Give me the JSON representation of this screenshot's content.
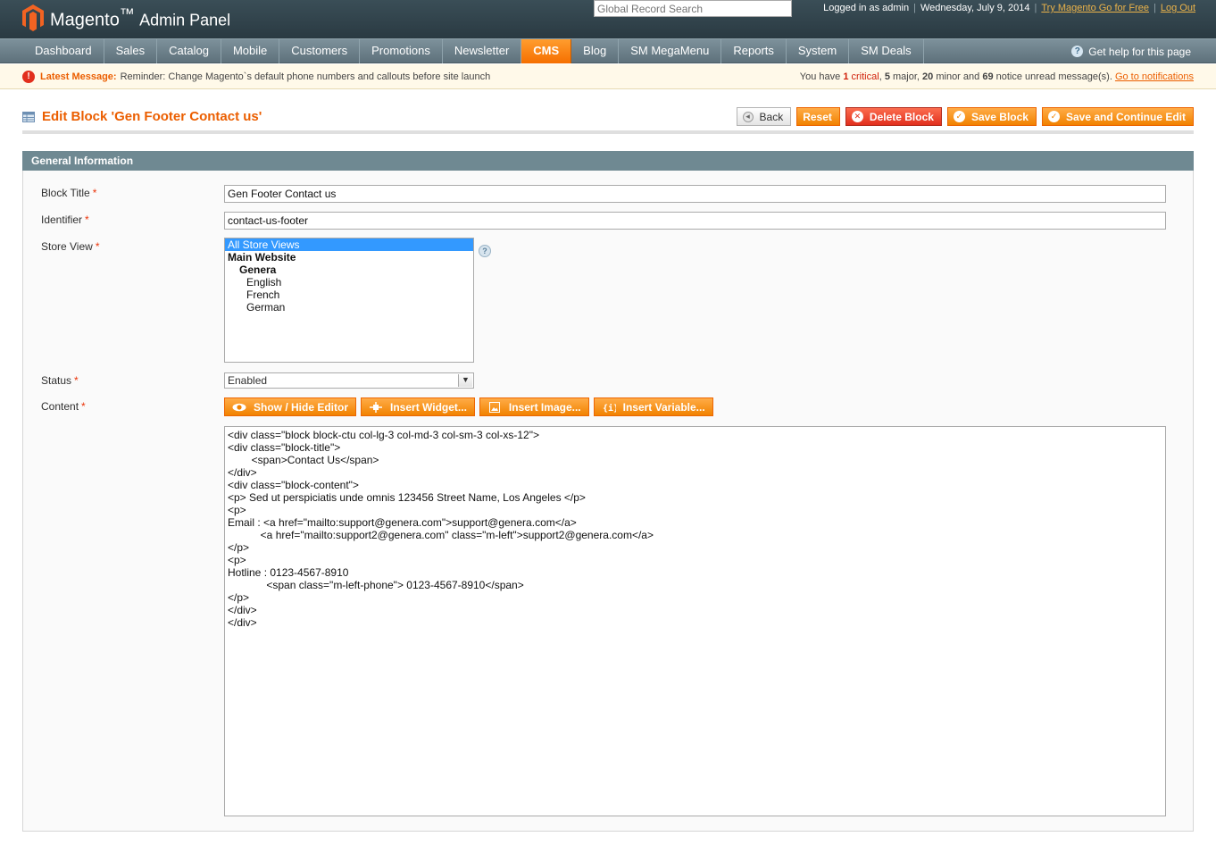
{
  "header": {
    "logo_brand": "Magento",
    "logo_sub": "Admin Panel",
    "search_placeholder": "Global Record Search",
    "logged_in": "Logged in as admin",
    "date": "Wednesday, July 9, 2014",
    "try_link": "Try Magento Go for Free",
    "logout_link": "Log Out"
  },
  "nav": {
    "items": [
      "Dashboard",
      "Sales",
      "Catalog",
      "Mobile",
      "Customers",
      "Promotions",
      "Newsletter",
      "CMS",
      "Blog",
      "SM MegaMenu",
      "Reports",
      "System",
      "SM Deals"
    ],
    "active": "CMS",
    "help": "Get help for this page"
  },
  "notice": {
    "label": "Latest Message:",
    "message": "Reminder: Change Magento`s default phone numbers and callouts before site launch",
    "pre": "You have",
    "critical_count": "1",
    "critical_label": "critical",
    "major_count": "5",
    "major_label": "major,",
    "minor_count": "20",
    "minor_label": "minor and",
    "notice_count": "69",
    "notice_label": "notice unread message(s).",
    "link": "Go to notifications"
  },
  "page": {
    "title": "Edit Block 'Gen Footer Contact us'",
    "buttons": {
      "back": "Back",
      "reset": "Reset",
      "delete": "Delete Block",
      "save": "Save Block",
      "save_continue": "Save and Continue Edit"
    }
  },
  "form": {
    "section_title": "General Information",
    "block_title_label": "Block Title",
    "block_title_value": "Gen Footer Contact us",
    "identifier_label": "Identifier",
    "identifier_value": "contact-us-footer",
    "store_view_label": "Store View",
    "store_options": {
      "all": "All Store Views",
      "website": "Main Website",
      "store": "Genera",
      "english": "English",
      "french": "French",
      "german": "German"
    },
    "status_label": "Status",
    "status_value": "Enabled",
    "content_label": "Content",
    "required_mark": "*",
    "editor_buttons": {
      "show_hide": "Show / Hide Editor",
      "widget": "Insert Widget...",
      "image": "Insert Image...",
      "variable": "Insert Variable..."
    },
    "content": "<div class=\"block block-ctu col-lg-3 col-md-3 col-sm-3 col-xs-12\">\n<div class=\"block-title\">\n        <span>Contact Us</span>\n</div>\n<div class=\"block-content\">\n<p> Sed ut perspiciatis unde omnis 123456 Street Name, Los Angeles </p>\n<p>\nEmail : <a href=\"mailto:support@genera.com\">support@genera.com</a>\n           <a href=\"mailto:support2@genera.com\" class=\"m-left\">support2@genera.com</a>\n</p>\n<p>\nHotline : 0123-4567-8910\n             <span class=\"m-left-phone\"> 0123-4567-8910</span>\n</p>\n</div>\n</div>"
  },
  "colors": {
    "accent": "#eb5e00",
    "header_bg": "#2f3f47",
    "nav_bg": "#6f838d",
    "section_bg": "#6f8992"
  }
}
